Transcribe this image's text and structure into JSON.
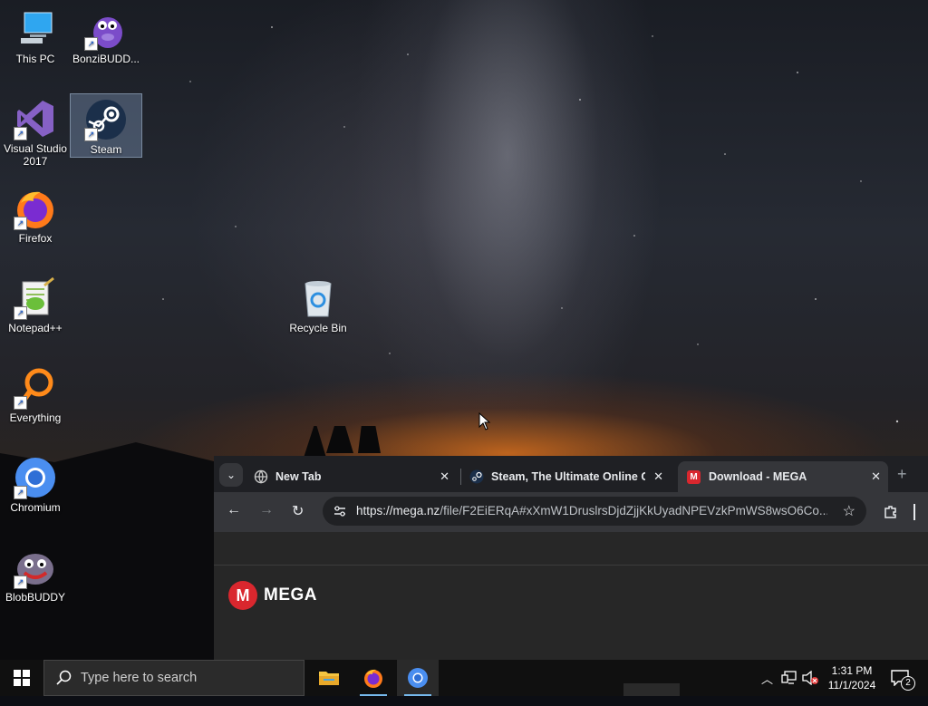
{
  "desktop": {
    "icons": [
      {
        "label": "This PC"
      },
      {
        "label": "BonziBUDD..."
      },
      {
        "label": "Visual Studio 2017"
      },
      {
        "label": "Steam"
      },
      {
        "label": "Firefox"
      },
      {
        "label": "Notepad++"
      },
      {
        "label": "Recycle Bin"
      },
      {
        "label": "Everything"
      },
      {
        "label": "Chromium"
      },
      {
        "label": "BlobBUDDY"
      }
    ]
  },
  "browser": {
    "tabs": [
      {
        "title": "New Tab",
        "icon": "globe-icon"
      },
      {
        "title": "Steam, The Ultimate Online Ga",
        "icon": "steam-icon"
      },
      {
        "title": "Download - MEGA",
        "icon": "mega-icon",
        "active": true
      }
    ],
    "url_host": "https://mega.nz",
    "url_path": "/file/F2EiERqA#xXmW1DruslrsDjdZjjKkUyadNPEVzkPmWS8wsO6Co...",
    "page": {
      "logo_letter": "M",
      "brand": "MEGA"
    }
  },
  "taskbar": {
    "search_placeholder": "Type here to search",
    "time": "1:31 PM",
    "date": "11/1/2024",
    "notification_count": "2"
  },
  "colors": {
    "mega_red": "#d9272e",
    "tab_active": "#35363a",
    "taskbar": "#101010"
  }
}
